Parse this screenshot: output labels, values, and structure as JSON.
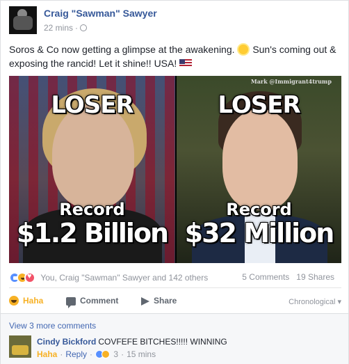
{
  "post": {
    "author": "Craig \"Sawman\" Sawyer",
    "time": "22 mins",
    "text_part1": "Soros & Co now getting a glimpse at the awakening.",
    "text_part2": "Sun's coming out & exposing the rancid! Let it shine!! USA!",
    "emoji_sun": "sun-icon",
    "emoji_flag": "us-flag-icon"
  },
  "image": {
    "watermark": "Mark @Immigrant4trump",
    "left": {
      "heading": "LOSER",
      "caption": "Record",
      "amount": "$1.2 Billion"
    },
    "right": {
      "heading": "LOSER",
      "caption": "Record",
      "amount": "$32 Million"
    }
  },
  "reactions": {
    "summary": "You, Craig \"Sawman\" Sawyer and 142 others",
    "comments_count": "5 Comments",
    "shares_count": "19 Shares",
    "types": [
      "like",
      "haha",
      "love"
    ],
    "colors": {
      "like": "#5890ff",
      "haha": "#f7b125",
      "love": "#f25268",
      "link": "#365899"
    }
  },
  "actions": {
    "reacted_label": "Haha",
    "comment_label": "Comment",
    "share_label": "Share",
    "sort_label": "Chronological"
  },
  "comments": {
    "view_more": "View 3 more comments",
    "items": [
      {
        "name": "Cindy Bickford",
        "text": "COVFEFE BITCHES!!!!! WINNING",
        "haha_label": "Haha",
        "reply_label": "Reply",
        "reaction_count": "3",
        "time": "15 mins"
      }
    ]
  }
}
